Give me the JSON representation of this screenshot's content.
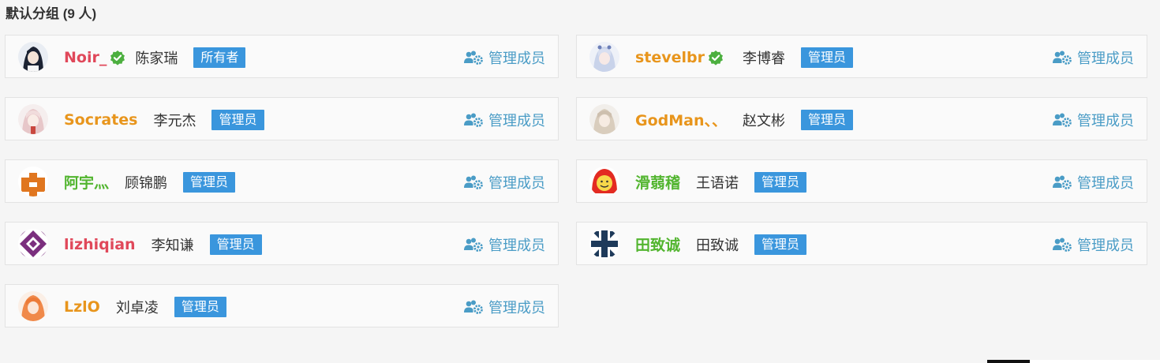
{
  "group": {
    "title": "默认分组 (9 人)"
  },
  "manage_label": "管理成员",
  "colors": {
    "accent_badge": "#3a96dd",
    "manage_link": "#4a9cc6",
    "verified": "#4caf3f"
  },
  "members": [
    {
      "nickname": "Noir_",
      "nickname_color": "#e0485a",
      "verified": true,
      "realname": "陈家瑞",
      "role": "所有者",
      "avatar_icon": "dark-hair-character-avatar"
    },
    {
      "nickname": "stevelbr",
      "nickname_color": "#e8951c",
      "verified": true,
      "realname": "李博睿",
      "role": "管理员",
      "avatar_icon": "white-hair-character-avatar"
    },
    {
      "nickname": "Socrates",
      "nickname_color": "#e8951c",
      "verified": false,
      "realname": "李元杰",
      "role": "管理员",
      "avatar_icon": "pink-hair-character-avatar"
    },
    {
      "nickname": "GodMan、、",
      "nickname_color": "#e8951c",
      "verified": false,
      "realname": "赵文彬",
      "role": "管理员",
      "avatar_icon": "blonde-character-avatar"
    },
    {
      "nickname": "阿宇灬",
      "nickname_color": "#52b52f",
      "verified": false,
      "realname": "顾锦鹏",
      "role": "管理员",
      "avatar_icon": "orange-pixel-avatar"
    },
    {
      "nickname": "滑蒻稽",
      "nickname_color": "#52b52f",
      "verified": false,
      "realname": "王语诺",
      "role": "管理员",
      "avatar_icon": "red-hood-face-avatar"
    },
    {
      "nickname": "lizhiqian",
      "nickname_color": "#e0485a",
      "verified": false,
      "realname": "李知谦",
      "role": "管理员",
      "avatar_icon": "purple-geometric-avatar"
    },
    {
      "nickname": "田致诚",
      "nickname_color": "#52b52f",
      "verified": false,
      "realname": "田致诚",
      "role": "管理员",
      "avatar_icon": "navy-pattern-avatar"
    },
    {
      "nickname": "LzlO",
      "nickname_color": "#e8951c",
      "verified": false,
      "realname": "刘卓凌",
      "role": "管理员",
      "avatar_icon": "orange-hair-character-avatar"
    }
  ]
}
